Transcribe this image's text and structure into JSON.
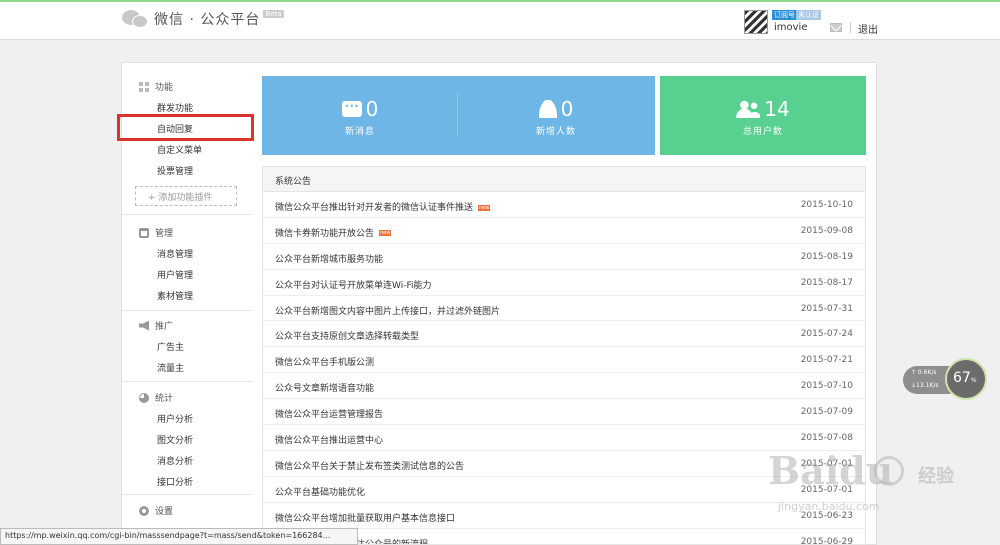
{
  "header": {
    "title": "微信 · 公众平台",
    "beta": "Beta",
    "user": {
      "name": "imovie",
      "badge_type": "订阅号",
      "badge_verified": "未认证"
    },
    "logout": "退出"
  },
  "sidebar": {
    "groups": [
      {
        "title": "功能",
        "icon": "grid-icon",
        "items": [
          "群发功能",
          "自动回复",
          "自定义菜单",
          "投票管理"
        ]
      },
      {
        "title": "管理",
        "icon": "tray-icon",
        "items": [
          "消息管理",
          "用户管理",
          "素材管理"
        ]
      },
      {
        "title": "推广",
        "icon": "megaphone-icon",
        "items": [
          "广告主",
          "流量主"
        ]
      },
      {
        "title": "统计",
        "icon": "pie-chart-icon",
        "items": [
          "用户分析",
          "图文分析",
          "消息分析",
          "接口分析"
        ]
      },
      {
        "title": "设置",
        "icon": "gear-icon",
        "items": []
      }
    ],
    "add_plugin": "+ 添加功能插件",
    "highlighted_item": "自动回复"
  },
  "stats": {
    "new_messages": {
      "value": "0",
      "label": "新消息",
      "icon": "chat-icon"
    },
    "new_users": {
      "value": "0",
      "label": "新增人数",
      "icon": "user-icon"
    },
    "total_users": {
      "value": "14",
      "label": "总用户数",
      "icon": "users-icon"
    },
    "colors": {
      "blue": "#6eb6e6",
      "green": "#58d08f"
    }
  },
  "notices": {
    "title": "系统公告",
    "rows": [
      {
        "text": "微信公众平台推出针对开发者的微信认证事件推送",
        "date": "2015-10-10",
        "new": true
      },
      {
        "text": "微信卡券新功能开放公告",
        "date": "2015-09-08",
        "new": true
      },
      {
        "text": "公众平台新增城市服务功能",
        "date": "2015-08-19",
        "new": false
      },
      {
        "text": "公众平台对认证号开放菜单连Wi-Fi能力",
        "date": "2015-08-17",
        "new": false
      },
      {
        "text": "公众平台新增图文内容中图片上传接口，并过滤外链图片",
        "date": "2015-07-31",
        "new": false
      },
      {
        "text": "公众平台支持原创文章选择转载类型",
        "date": "2015-07-24",
        "new": false
      },
      {
        "text": "微信公众平台手机版公测",
        "date": "2015-07-21",
        "new": false
      },
      {
        "text": "公众号文章新增语音功能",
        "date": "2015-07-10",
        "new": false
      },
      {
        "text": "微信公众平台运营管理报告",
        "date": "2015-07-09",
        "new": false
      },
      {
        "text": "微信公众平台推出运营中心",
        "date": "2015-07-08",
        "new": false
      },
      {
        "text": "微信公众平台关于禁止发布签类测试信息的公告",
        "date": "2015-07-01",
        "new": false
      },
      {
        "text": "公众平台基础功能优化",
        "date": "2015-07-01",
        "new": false
      },
      {
        "text": "微信公众平台增加批量获取用户基本信息接口",
        "date": "2015-06-23",
        "new": false
      },
      {
        "text": "公众平台上线网后关注公众号的新流程",
        "date": "2015-06-29",
        "new": false
      }
    ],
    "new_tag": "new"
  },
  "statusbar": {
    "url": "https://mp.weixin.qq.com/cgi-bin/masssendpage?t=mass/send&token=166284..."
  },
  "network_widget": {
    "up": "↑ 0.6K/s",
    "down": "↓13.1K/s",
    "percent": "67",
    "percent_sign": "%"
  },
  "watermark": {
    "brand": "Baidu",
    "brand_cn": "经验",
    "url": "jingyan.baidu.com"
  }
}
